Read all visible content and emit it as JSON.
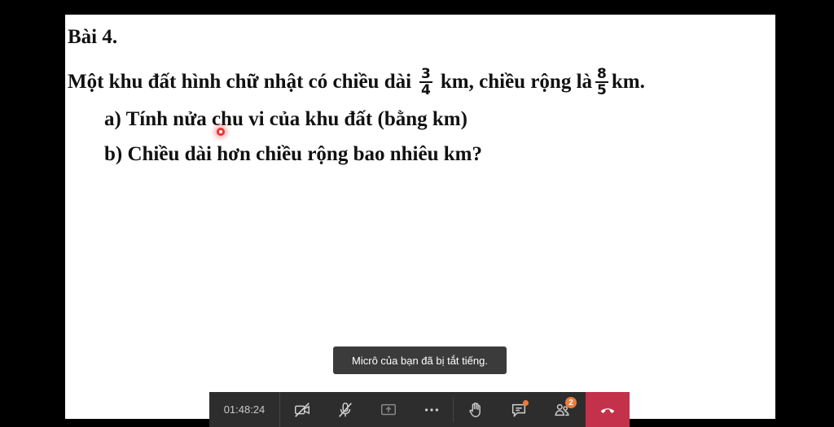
{
  "slide": {
    "title": "Bài 4.",
    "problem": {
      "part1": "Một khu đất hình chữ nhật có chiều dài",
      "length_num": "3",
      "length_den": "4",
      "part2": "km, chiều rộng là",
      "width_num": "8",
      "width_den": "5",
      "part3": "km."
    },
    "question_a": "a) Tính nửa chu vi của khu đất (bằng km)",
    "question_b": "b) Chiều dài hơn chiều rộng bao nhiêu km?"
  },
  "toast": {
    "message": "Micrô của bạn đã bị tắt tiếng."
  },
  "call_bar": {
    "timer": "01:48:24",
    "participants_badge": "2",
    "icons": [
      "camera-off-icon",
      "mic-off-icon",
      "share-screen-icon",
      "more-icon",
      "raise-hand-icon",
      "chat-icon",
      "participants-icon",
      "hang-up-icon"
    ],
    "colors": {
      "bar": "#2d2d2d",
      "hangup": "#c4314b",
      "badge": "#ee7a3b"
    }
  }
}
